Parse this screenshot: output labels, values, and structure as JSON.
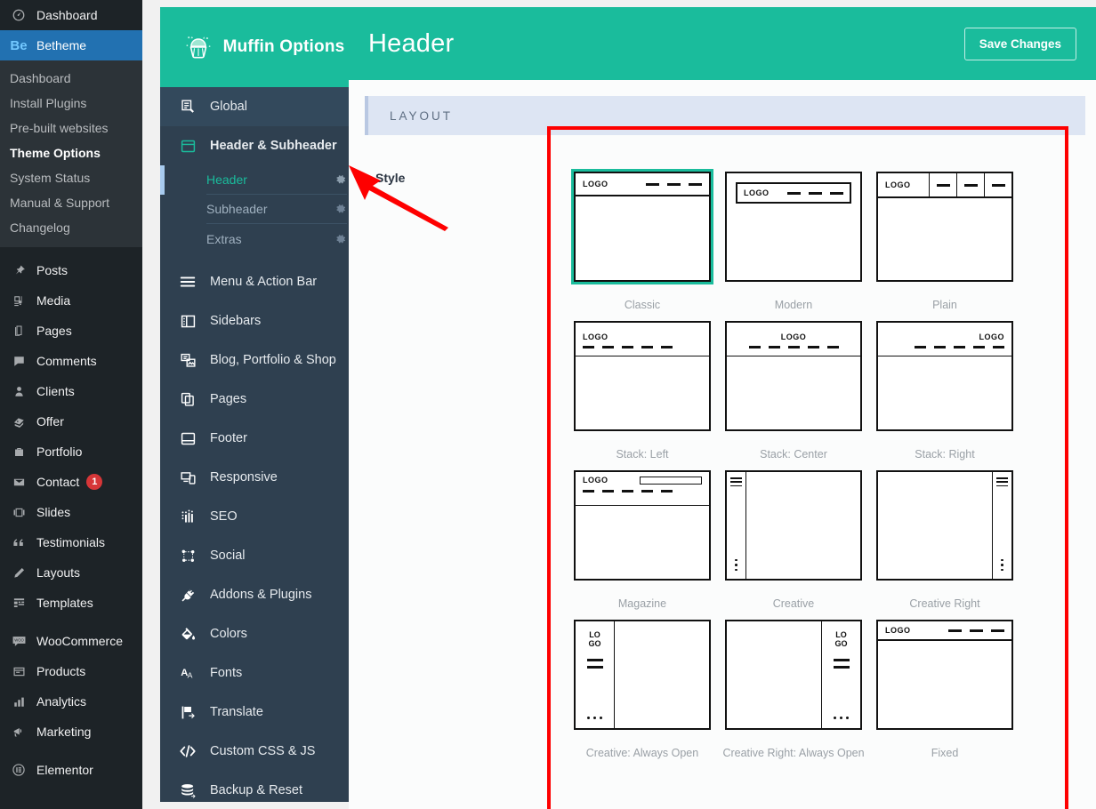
{
  "wp_sidebar": {
    "top_items": [
      {
        "label": "Dashboard",
        "icon": "dashboard-icon",
        "current": false
      }
    ],
    "betheme": {
      "label": "Betheme",
      "mark": "Be",
      "current": true,
      "submenu": [
        {
          "label": "Dashboard",
          "active": false
        },
        {
          "label": "Install Plugins",
          "active": false
        },
        {
          "label": "Pre-built websites",
          "active": false
        },
        {
          "label": "Theme Options",
          "active": true
        },
        {
          "label": "System Status",
          "active": false
        },
        {
          "label": "Manual & Support",
          "active": false
        },
        {
          "label": "Changelog",
          "active": false
        }
      ]
    },
    "group_content": [
      {
        "label": "Posts",
        "icon": "pin-icon"
      },
      {
        "label": "Media",
        "icon": "media-icon"
      },
      {
        "label": "Pages",
        "icon": "pages-icon"
      },
      {
        "label": "Comments",
        "icon": "comments-icon"
      },
      {
        "label": "Clients",
        "icon": "user-icon"
      },
      {
        "label": "Offer",
        "icon": "offer-icon"
      },
      {
        "label": "Portfolio",
        "icon": "portfolio-icon"
      },
      {
        "label": "Contact",
        "icon": "envelope-icon",
        "badge": "1"
      },
      {
        "label": "Slides",
        "icon": "slides-icon"
      },
      {
        "label": "Testimonials",
        "icon": "quote-icon"
      },
      {
        "label": "Layouts",
        "icon": "pencil-icon"
      },
      {
        "label": "Templates",
        "icon": "templates-icon"
      }
    ],
    "group_woo": [
      {
        "label": "WooCommerce",
        "icon": "woo-icon"
      },
      {
        "label": "Products",
        "icon": "products-icon"
      },
      {
        "label": "Analytics",
        "icon": "analytics-icon"
      },
      {
        "label": "Marketing",
        "icon": "megaphone-icon"
      }
    ],
    "group_other": [
      {
        "label": "Elementor",
        "icon": "elementor-icon"
      }
    ]
  },
  "muffin": {
    "title": "Muffin Options",
    "logo_icon": "cupcake-icon",
    "nav": [
      {
        "label": "Global",
        "icon": "global-edit-icon",
        "state": "hover"
      },
      {
        "label": "Header & Subheader",
        "icon": "header-box-icon",
        "state": "open"
      }
    ],
    "header_subitems": [
      {
        "label": "Header",
        "selected": true,
        "gear": "gear-icon"
      },
      {
        "label": "Subheader",
        "selected": false,
        "gear": "gear-icon"
      },
      {
        "label": "Extras",
        "selected": false,
        "gear": "gear-icon"
      }
    ],
    "nav_rest": [
      {
        "label": "Menu & Action Bar",
        "icon": "hamburger-icon"
      },
      {
        "label": "Sidebars",
        "icon": "sidebar-icon"
      },
      {
        "label": "Blog, Portfolio & Shop",
        "icon": "blog-icon"
      },
      {
        "label": "Pages",
        "icon": "copy-pages-icon"
      },
      {
        "label": "Footer",
        "icon": "footer-icon"
      },
      {
        "label": "Responsive",
        "icon": "responsive-icon"
      },
      {
        "label": "SEO",
        "icon": "seo-bars-icon"
      },
      {
        "label": "Social",
        "icon": "social-share-icon"
      },
      {
        "label": "Addons & Plugins",
        "icon": "plug-icon"
      },
      {
        "label": "Colors",
        "icon": "paint-bucket-icon"
      },
      {
        "label": "Fonts",
        "icon": "fonts-aa-icon"
      },
      {
        "label": "Translate",
        "icon": "flag-translate-icon"
      },
      {
        "label": "Custom CSS & JS",
        "icon": "code-icon"
      },
      {
        "label": "Backup & Reset",
        "icon": "database-icon"
      }
    ]
  },
  "topbar": {
    "title": "Header",
    "save_label": "Save Changes"
  },
  "content": {
    "section_title": "LAYOUT",
    "field_label": "Style",
    "styles": [
      {
        "name": "Classic",
        "variant": "classic",
        "selected": true
      },
      {
        "name": "Modern",
        "variant": "modern",
        "selected": false
      },
      {
        "name": "Plain",
        "variant": "plain",
        "selected": false
      },
      {
        "name": "Stack: Left",
        "variant": "stack-left",
        "selected": false
      },
      {
        "name": "Stack: Center",
        "variant": "stack-center",
        "selected": false
      },
      {
        "name": "Stack: Right",
        "variant": "stack-right",
        "selected": false
      },
      {
        "name": "Magazine",
        "variant": "magazine",
        "selected": false
      },
      {
        "name": "Creative",
        "variant": "creative-left",
        "selected": false
      },
      {
        "name": "Creative Right",
        "variant": "creative-right",
        "selected": false
      },
      {
        "name": "Creative: Always Open",
        "variant": "copen-left",
        "selected": false
      },
      {
        "name": "Creative Right: Always Open",
        "variant": "copen-right",
        "selected": false
      },
      {
        "name": "Fixed",
        "variant": "fixed",
        "selected": false
      }
    ],
    "thumb_logo_text": "LOGO",
    "thumb_logo_stacked_top": "LO",
    "thumb_logo_stacked_bottom": "GO"
  },
  "annotations": {
    "highlight_rect_color": "#fe0000",
    "arrow_color": "#fe0000"
  },
  "colors": {
    "wp_sidebar_bg": "#1d2327",
    "wp_submenu_bg": "#2c3338",
    "wp_current_blue": "#2271b1",
    "muffin_teal": "#1abc9c",
    "muffin_panel_bg": "#2f4050",
    "muffin_nav_hover": "#33495c",
    "layout_bar_bg": "#dde5f3",
    "badge_red": "#d63638"
  }
}
